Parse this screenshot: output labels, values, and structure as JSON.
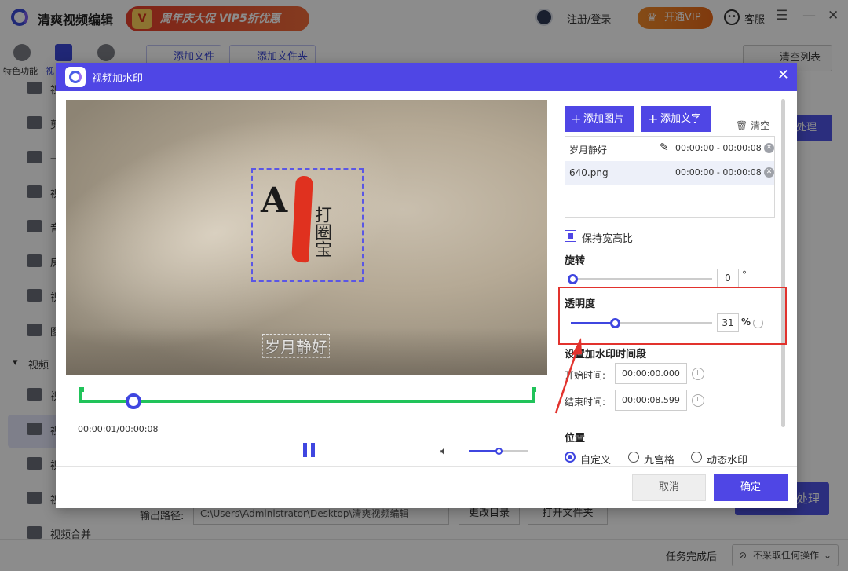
{
  "app": {
    "title": "清爽视频编辑",
    "promo": "周年庆大促 VIP5折优惠",
    "promo_badge": "V",
    "login": "注册/登录",
    "vip_button": "开通VIP",
    "service": "客服",
    "window_controls": [
      "☰",
      "—",
      "✕"
    ]
  },
  "sidebar": {
    "tab_featured": "特色功能",
    "tab_video_prefix": "视",
    "group_label": "视频",
    "item_prefixes": [
      "视",
      "剪",
      "一",
      "视",
      "音",
      "房",
      "视",
      "图",
      "视",
      "视",
      "视",
      "视"
    ],
    "bottom_item": "视频合并"
  },
  "toolbar": {
    "add_file": "添加文件",
    "add_folder": "添加文件夹",
    "clear_list": "清空列表",
    "process": "处理",
    "process_big": "处理"
  },
  "output": {
    "label": "输出路径:",
    "path": "C:\\Users\\Administrator\\Desktop\\清爽视频编辑",
    "change_dir": "更改目录",
    "open_folder": "打开文件夹"
  },
  "status": {
    "after_label": "任务完成后",
    "after_value": "不采取任何操作"
  },
  "dialog": {
    "title": "视频加水印",
    "close": "✕",
    "video": {
      "watermark_text": "岁月静好",
      "watermark_letters": "A",
      "watermark_chars": "打圈宝",
      "current_time": "00:00:01/00:00:08",
      "timeline_progress": 0.12,
      "volume_level": 0.5
    },
    "panel": {
      "add_image": "添加图片",
      "add_text": "添加文字",
      "clear": "清空",
      "watermarks": [
        {
          "name": "岁月静好",
          "start": "00:00:00",
          "end": "00:00:08",
          "editable": true
        },
        {
          "name": "640.png",
          "start": "00:00:00",
          "end": "00:00:08",
          "editable": false
        }
      ],
      "keep_ratio": "保持宽高比",
      "rotation_label": "旋转",
      "rotation_value": "0",
      "rotation_unit": "°",
      "opacity_label": "透明度",
      "opacity_value": "31",
      "opacity_unit": "%",
      "opacity_fraction": 0.31,
      "period_label": "设置加水印时间段",
      "start_label": "开始时间:",
      "start_value": "00:00:00.000",
      "end_label": "结束时间:",
      "end_value": "00:00:08.599",
      "position_label": "位置",
      "positions": [
        "自定义",
        "九宫格",
        "动态水印"
      ],
      "position_selected": 0
    },
    "cancel": "取消",
    "confirm": "确定"
  },
  "colors": {
    "accent": "#4f46e5",
    "timeline": "#21c35a",
    "highlight": "#e2322d"
  }
}
